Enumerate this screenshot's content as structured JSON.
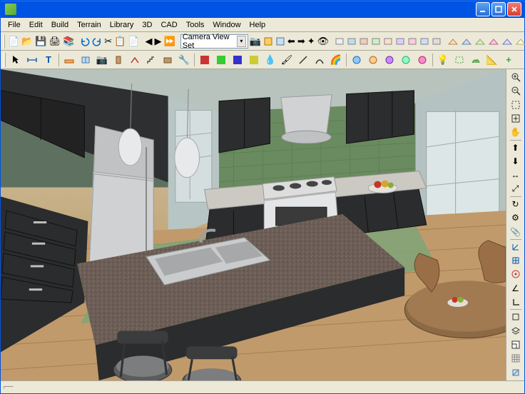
{
  "window": {
    "title": ""
  },
  "menu": {
    "items": [
      "File",
      "Edit",
      "Build",
      "Terrain",
      "Library",
      "3D",
      "CAD",
      "Tools",
      "Window",
      "Help"
    ]
  },
  "toolbar1": {
    "camera_view": "Camera View Set",
    "icons": [
      "new-file-icon",
      "open-file-icon",
      "save-icon",
      "print-icon",
      "library-icon",
      "undo-icon",
      "redo-icon",
      "cut-icon",
      "copy-icon",
      "paste-icon",
      "prev-icon",
      "play-icon",
      "next-icon",
      "camera-icon",
      "nav-left-icon",
      "nav-right-icon",
      "nav-turn-l-icon",
      "nav-turn-r-icon",
      "cross-section-icon",
      "walkthrough-icon",
      "render-a-icon",
      "render-b-icon",
      "render-c-icon",
      "render-d-icon",
      "render-e-icon",
      "render-f-icon",
      "render-g-icon",
      "render-h-icon",
      "render-i-icon",
      "render-j-icon",
      "view-a-icon",
      "view-b-icon",
      "view-c-icon",
      "view-d-icon",
      "view-e-icon",
      "view-f-icon",
      "view-g-icon",
      "view-h-icon",
      "view-i-icon"
    ]
  },
  "toolbar2": {
    "icons": [
      "select-icon",
      "dimension-icon",
      "text-icon",
      "wall-icon",
      "window-icon",
      "camera-tool-icon",
      "door-icon",
      "roof-icon",
      "stairs-icon",
      "cabinet-icon",
      "fixture-icon",
      "color-a-icon",
      "color-b-icon",
      "color-c-icon",
      "color-d-icon",
      "eyedropper-icon",
      "brush-icon",
      "line-icon",
      "curve-icon",
      "rainbow-icon",
      "material-a-icon",
      "material-b-icon",
      "material-c-icon",
      "material-d-icon",
      "material-e-icon",
      "light-icon",
      "region-icon",
      "terrain-icon",
      "elevation-icon",
      "add-icon"
    ]
  },
  "right_toolbar": {
    "icons": [
      "zoom-in-icon",
      "zoom-out-icon",
      "zoom-window-icon",
      "fill-window-icon",
      "pan-icon",
      "pan-up-icon",
      "pan-down-icon",
      "pan-lr-icon",
      "pan-diag-icon",
      "refresh-icon",
      "preferences-icon",
      "reference-icon",
      "angle-icon",
      "grid-toggle-icon",
      "snap-icon",
      "snap-angle-icon",
      "ortho-icon",
      "dimension-sq-icon",
      "layers-icon",
      "plan-icon",
      "grid-sm-icon",
      "section-icon"
    ]
  },
  "status": {
    "text": ""
  },
  "colors": {
    "window_chrome": "#ece9d8",
    "accent": "#0054e3",
    "cabinet_dark": "#2a2c2d",
    "tile_green": "#6a8a5f",
    "floor_wood": "#c19a6b",
    "counter_granite": "#6b5d55",
    "rug_green": "#7fa578",
    "appliance_steel": "#c9cbcc"
  }
}
